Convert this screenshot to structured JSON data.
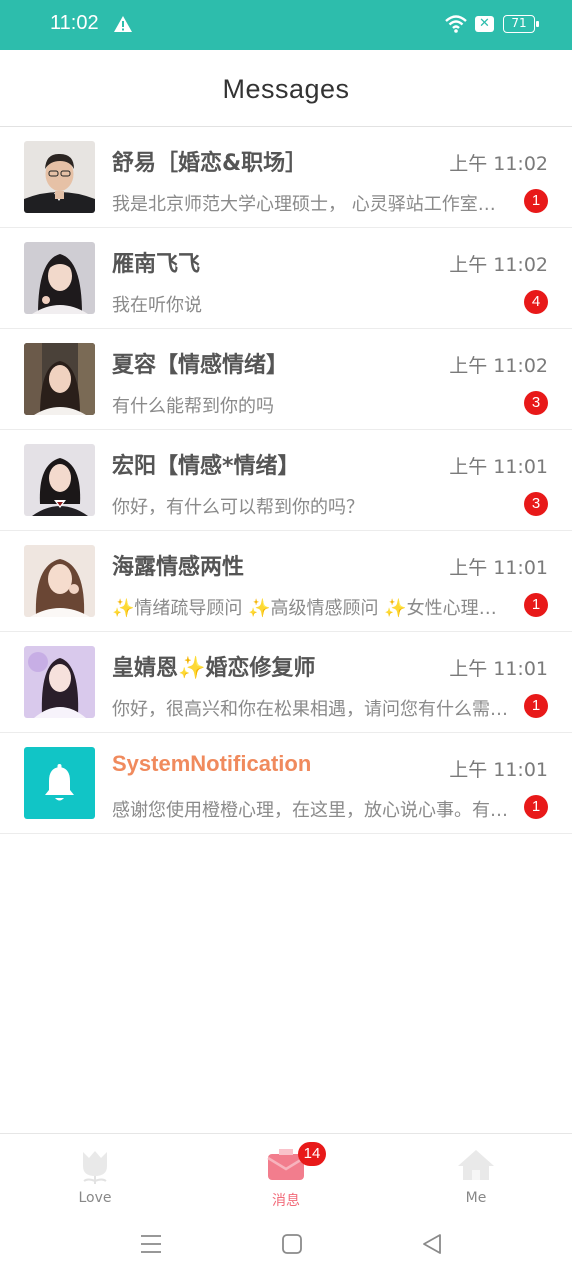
{
  "status_bar": {
    "time": "11:02",
    "battery": "71",
    "icons": [
      "warning-icon",
      "wifi-icon",
      "sim-off-icon",
      "battery-icon"
    ]
  },
  "header": {
    "title": "Messages"
  },
  "conversations": [
    {
      "name": "舒易［婚恋&职场］",
      "time": "上午 11:02",
      "preview": "我是北京师范大学心理硕士， 心灵驿站工作室创始人",
      "unread": "1"
    },
    {
      "name": "雁南飞飞",
      "time": "上午 11:02",
      "preview": "我在听你说",
      "unread": "4"
    },
    {
      "name": "夏容【情感情绪】",
      "time": "上午 11:02",
      "preview": "有什么能帮到你的吗",
      "unread": "3"
    },
    {
      "name": "宏阳【情感*情绪】",
      "time": "上午 11:01",
      "preview": "你好，有什么可以帮到你的吗？",
      "unread": "3"
    },
    {
      "name": "海露情感两性",
      "time": "上午 11:01",
      "preview": "✨情绪疏导顾问 ✨高级情感顾问 ✨女性心理成长导师",
      "unread": "1"
    },
    {
      "name": "皇婧恩✨婚恋修复师",
      "time": "上午 11:01",
      "preview": "你好，很高兴和你在松果相遇，请问您有什么需要帮助的",
      "unread": "1"
    },
    {
      "name": "SystemNotification",
      "time": "上午 11:01",
      "preview": "感谢您使用橙橙心理，在这里，放心说心事。有任何问题",
      "unread": "1"
    }
  ],
  "tabbar": {
    "tabs": [
      {
        "label": "Love",
        "icon": "tulip-icon"
      },
      {
        "label": "消息",
        "icon": "envelope-icon",
        "badge": "14"
      },
      {
        "label": "Me",
        "icon": "house-icon"
      }
    ]
  },
  "colors": {
    "status_bar": "#2dbdac",
    "badge": "#e81919",
    "system_name": "#f08a5d",
    "active_tab": "#f26b7a",
    "system_avatar": "#11c5c6"
  }
}
